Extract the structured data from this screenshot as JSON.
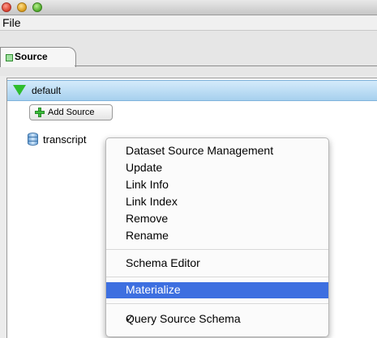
{
  "menubar": {
    "file": "File"
  },
  "tabs": [
    {
      "label": "Source"
    }
  ],
  "tree": {
    "group_label": "default",
    "add_source_label": "Add Source",
    "source_label": "transcript"
  },
  "context_menu": {
    "items": [
      "Dataset Source Management",
      "Update",
      "Link Info",
      "Link Index",
      "Remove",
      "Rename",
      "Schema Editor",
      "Materialize",
      "Query Source Schema"
    ],
    "highlighted": "Materialize",
    "check_mark": "✓",
    "checked_item": "Query Source Schema",
    "highlight_color": "#3d6fe0"
  },
  "colors": {
    "selection": "#a6d0ee",
    "tree_icon": "#2ebd2e",
    "add_icon": "#3cbf3c",
    "db_icon": "#6fa4d8"
  }
}
